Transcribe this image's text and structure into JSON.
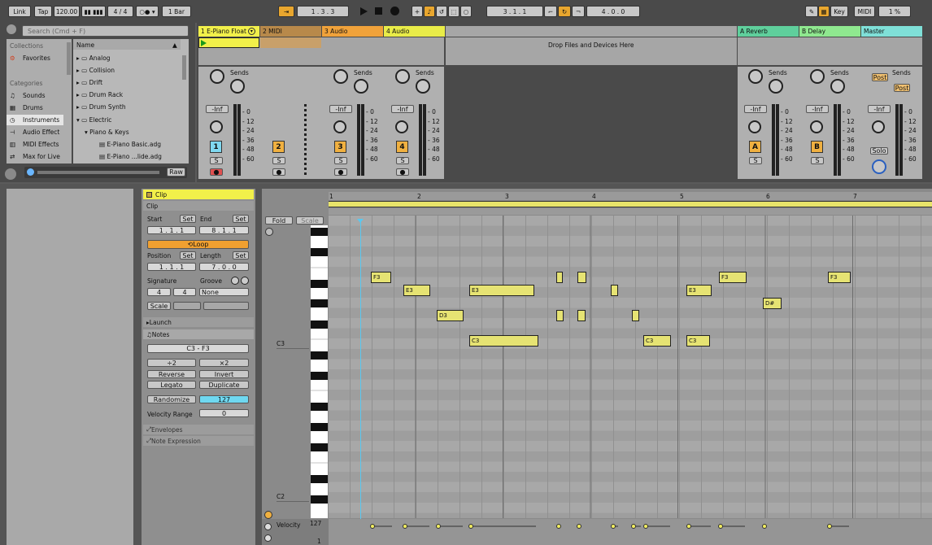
{
  "transport": {
    "link": "Link",
    "tap": "Tap",
    "tempo": "120.00",
    "signature": "4 / 4",
    "quantize": "1 Bar",
    "position": "1 . 3 . 3",
    "loop_start": "3 . 1 . 1",
    "loop_length": "4 . 0 . 0",
    "key": "Key",
    "midi": "MIDI",
    "cpu": "1 %"
  },
  "browser": {
    "search_placeholder": "Search (Cmd + F)",
    "collections_header": "Collections",
    "favorites": "Favorites",
    "categories_header": "Categories",
    "categories": [
      "Sounds",
      "Drums",
      "Instruments",
      "Audio Effect",
      "MIDI Effects",
      "Max for Live"
    ],
    "name_header": "Name",
    "items": [
      "Analog",
      "Collision",
      "Drift",
      "Drum Rack",
      "Drum Synth",
      "Electric",
      "Piano & Keys",
      "E-Piano Basic.adg",
      "E-Piano ...lide.adg"
    ],
    "raw": "Raw"
  },
  "tracks": [
    {
      "name": "1 E-Piano Float",
      "color": "#f2f04a",
      "num": "1",
      "vol": "-Inf"
    },
    {
      "name": "2 MIDI",
      "color": "#b8894a",
      "num": "2",
      "vol": ""
    },
    {
      "name": "3 Audio",
      "color": "#f0a23a",
      "num": "3",
      "vol": "-Inf"
    },
    {
      "name": "4 Audio",
      "color": "#e9ec48",
      "num": "4",
      "vol": "-Inf"
    },
    {
      "name": "A Reverb",
      "color": "#5fcf9c",
      "num": "A",
      "vol": "-Inf"
    },
    {
      "name": "B Delay",
      "color": "#8fe88f",
      "num": "B",
      "vol": "-Inf"
    },
    {
      "name": "Master",
      "color": "#7fe0d8",
      "num": "",
      "vol": "-Inf"
    }
  ],
  "drop_text": "Drop Files and Devices Here",
  "sends_label": "Sends",
  "meter_scale": [
    "0",
    "12",
    "24",
    "36",
    "48",
    "60"
  ],
  "post": "Post",
  "solo": "Solo",
  "clip": {
    "title": "Clip",
    "section": "Clip",
    "start": "Start",
    "end": "End",
    "set": "Set",
    "start_val": "1 .   1 .   1",
    "end_val": "8 .   1 .   1",
    "loop": "Loop",
    "position": "Position",
    "length": "Length",
    "position_val": "1 .   1 .   1",
    "length_val": "7 .   0 .   0",
    "signature": "Signature",
    "groove": "Groove",
    "sig_num": "4",
    "sig_den": "4",
    "groove_val": "None",
    "scale": "Scale",
    "launch": "Launch",
    "notes": "Notes",
    "range": "C3 - F3",
    "half": "÷2",
    "double": "×2",
    "reverse": "Reverse",
    "invert": "Invert",
    "legato": "Legato",
    "duplicate": "Duplicate",
    "randomize": "Randomize",
    "randomize_val": "127",
    "velocity_range": "Velocity Range",
    "velocity_range_val": "0",
    "envelopes": "Envelopes",
    "note_expression": "Note Expression"
  },
  "piano_roll": {
    "fold": "Fold",
    "scale": "Scale",
    "bars": [
      "1",
      "2",
      "3",
      "4",
      "5",
      "6",
      "7"
    ],
    "key_labels": [
      "C3",
      "C2"
    ],
    "velocity_label": "Velocity",
    "velocity_max": "127",
    "velocity_min": "1",
    "notes": [
      {
        "label": "F3"
      },
      {
        "label": "E3"
      },
      {
        "label": "D3"
      },
      {
        "label": "E3"
      },
      {
        "label": "C3"
      },
      {
        "label": ""
      },
      {
        "label": ""
      },
      {
        "label": ""
      },
      {
        "label": ""
      },
      {
        "label": ""
      },
      {
        "label": ""
      },
      {
        "label": "C3"
      },
      {
        "label": "E3"
      },
      {
        "label": "C3"
      },
      {
        "label": "F3"
      },
      {
        "label": "D#"
      },
      {
        "label": "F3"
      }
    ]
  }
}
